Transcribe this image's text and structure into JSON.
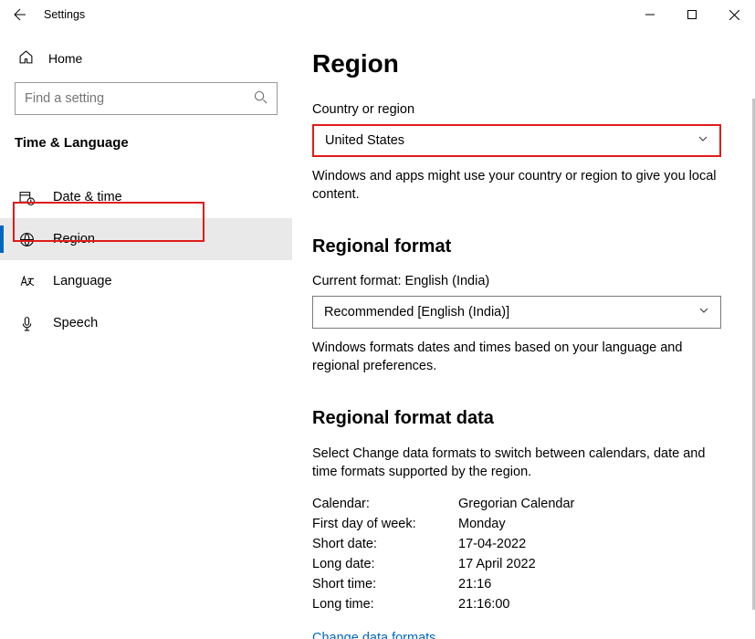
{
  "titlebar": {
    "title": "Settings"
  },
  "sidebar": {
    "home_label": "Home",
    "search_placeholder": "Find a setting",
    "section_title": "Time & Language",
    "items": [
      {
        "label": "Date & time"
      },
      {
        "label": "Region"
      },
      {
        "label": "Language"
      },
      {
        "label": "Speech"
      }
    ]
  },
  "main": {
    "heading": "Region",
    "country_label": "Country or region",
    "country_value": "United States",
    "country_desc": "Windows and apps might use your country or region to give you local content.",
    "reg_format_heading": "Regional format",
    "current_format_label": "Current format: English (India)",
    "reg_format_value": "Recommended [English (India)]",
    "reg_format_desc": "Windows formats dates and times based on your language and regional preferences.",
    "reg_data_heading": "Regional format data",
    "reg_data_desc": "Select Change data formats to switch between calendars, date and time formats supported by the region.",
    "kv": [
      {
        "k": "Calendar:",
        "v": "Gregorian Calendar"
      },
      {
        "k": "First day of week:",
        "v": "Monday"
      },
      {
        "k": "Short date:",
        "v": "17-04-2022"
      },
      {
        "k": "Long date:",
        "v": "17 April 2022"
      },
      {
        "k": "Short time:",
        "v": "21:16"
      },
      {
        "k": "Long time:",
        "v": "21:16:00"
      }
    ],
    "change_link": "Change data formats"
  }
}
